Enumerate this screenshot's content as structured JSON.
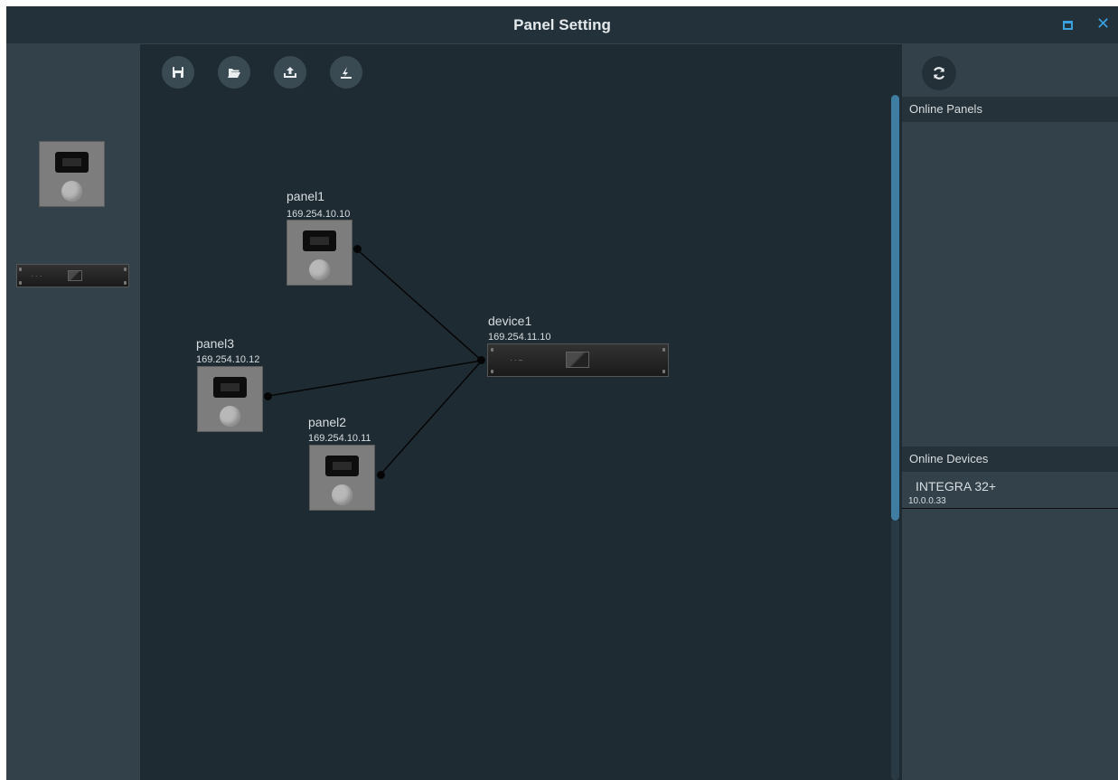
{
  "window": {
    "title": "Panel Setting",
    "maximize_icon": "maximize-icon",
    "close_icon": "close-icon",
    "close_label": "✕"
  },
  "toolbar": {
    "buttons": [
      {
        "name": "save",
        "icon": "save-icon"
      },
      {
        "name": "open",
        "icon": "folder-open-icon"
      },
      {
        "name": "upload",
        "icon": "upload-icon"
      },
      {
        "name": "download",
        "icon": "download-icon"
      }
    ]
  },
  "palette": {
    "items": [
      {
        "type": "panel",
        "icon": "panel-device-icon"
      },
      {
        "type": "device",
        "icon": "rack-device-icon"
      }
    ]
  },
  "canvas": {
    "panels": [
      {
        "name": "panel1",
        "ip": "169.254.10.10"
      },
      {
        "name": "panel3",
        "ip": "169.254.10.12"
      },
      {
        "name": "panel2",
        "ip": "169.254.10.11"
      }
    ],
    "device": {
      "name": "device1",
      "ip": "169.254.11.10"
    },
    "connections": [
      [
        "panel1",
        "device1"
      ],
      [
        "panel3",
        "device1"
      ],
      [
        "panel2",
        "device1"
      ]
    ]
  },
  "right_panel": {
    "refresh_icon": "refresh-icon",
    "online_panels_label": "Online Panels",
    "online_devices_label": "Online Devices",
    "online_panels": [],
    "online_devices": [
      {
        "name": "INTEGRA 32+",
        "ip": "10.0.0.33"
      }
    ]
  },
  "colors": {
    "background": "#1f2b33",
    "sidebar": "#33424a",
    "accent": "#3aa0e0",
    "scrollbar": "#3f7da2"
  }
}
